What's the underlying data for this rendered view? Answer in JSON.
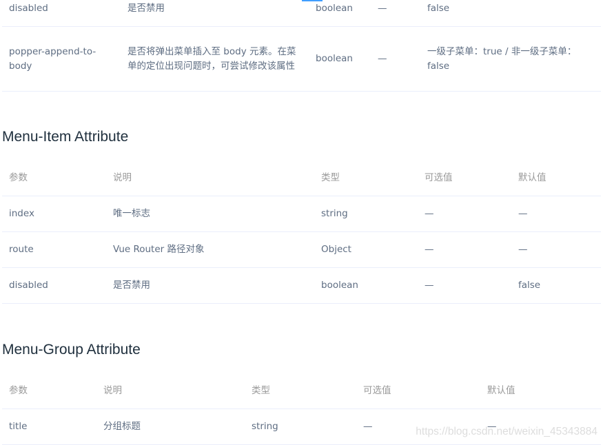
{
  "submenu_table": {
    "rows": [
      [
        "disabled",
        "是否禁用",
        "boolean",
        "—",
        "false"
      ],
      [
        "popper-append-to-body",
        "是否将弹出菜单插入至 body 元素。在菜单的定位出现问题时，可尝试修改该属性",
        "boolean",
        "—",
        "一级子菜单：true / 非一级子菜单：false"
      ]
    ]
  },
  "menu_item": {
    "title": "Menu-Item Attribute",
    "headers": [
      "参数",
      "说明",
      "类型",
      "可选值",
      "默认值"
    ],
    "rows": [
      [
        "index",
        "唯一标志",
        "string",
        "—",
        "—"
      ],
      [
        "route",
        "Vue Router 路径对象",
        "Object",
        "—",
        "—"
      ],
      [
        "disabled",
        "是否禁用",
        "boolean",
        "—",
        "false"
      ]
    ]
  },
  "menu_group": {
    "title": "Menu-Group Attribute",
    "headers": [
      "参数",
      "说明",
      "类型",
      "可选值",
      "默认值"
    ],
    "rows": [
      [
        "title",
        "分组标题",
        "string",
        "—",
        "—"
      ]
    ]
  },
  "watermark": "https://blog.csdn.net/weixin_45343884",
  "colors": {
    "accent": "#409eff",
    "text": "#5e6d82",
    "heading": "#1f2f3d",
    "header_text": "#999999",
    "border": "#eaeefb"
  }
}
